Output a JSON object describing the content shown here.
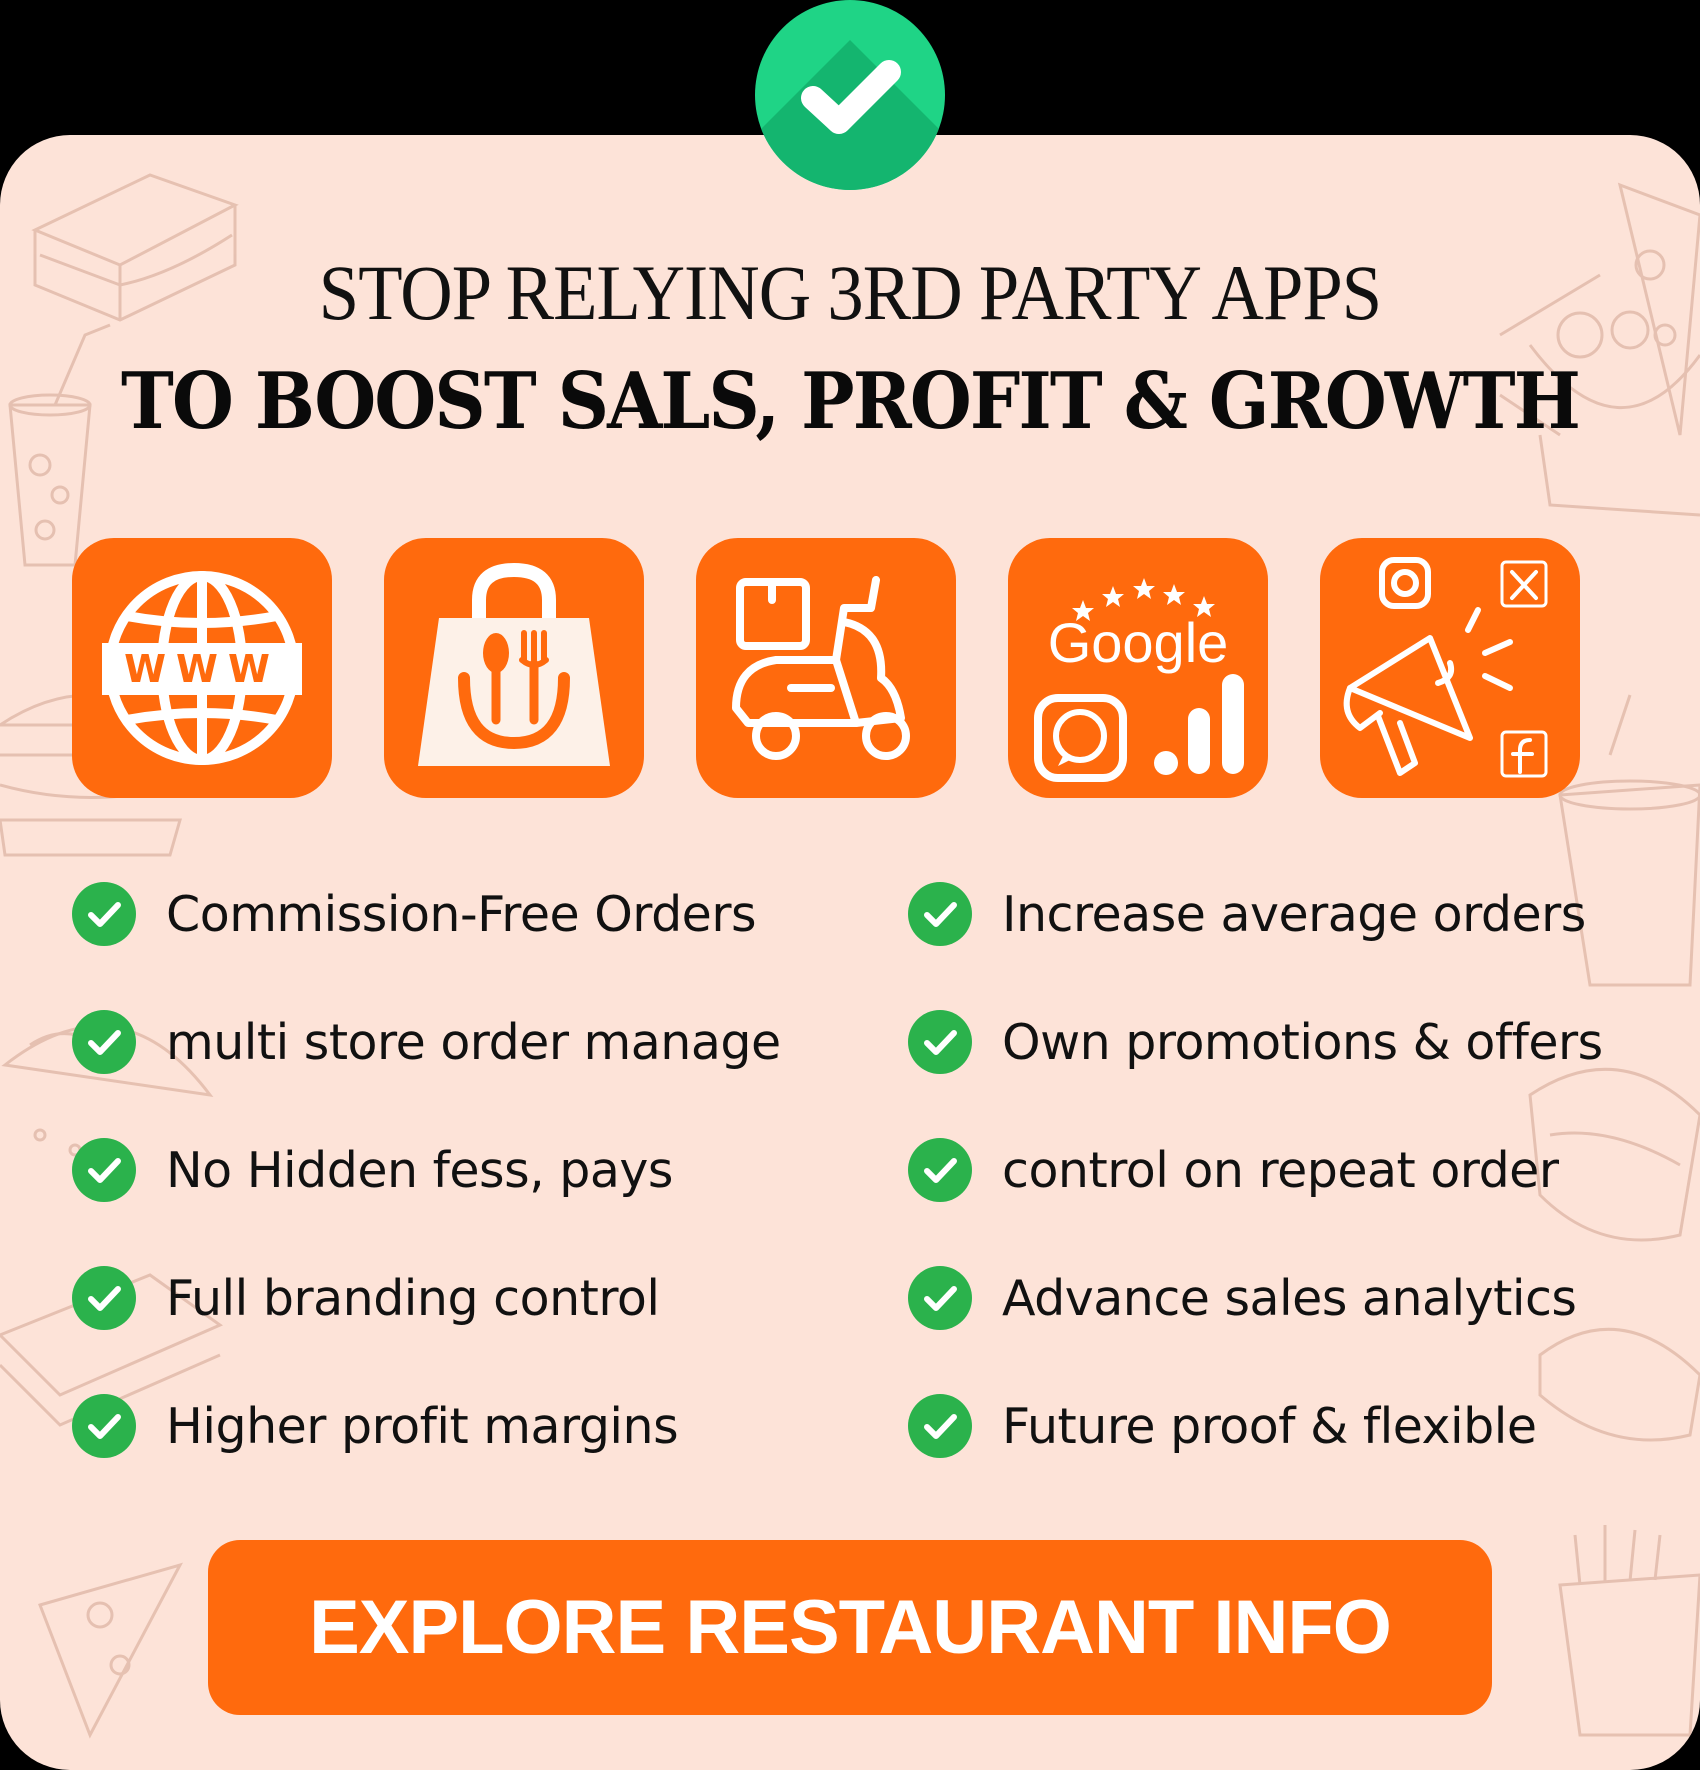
{
  "headline": {
    "line1": "STOP RELYING 3RD PARTY APPS",
    "line2": "TO BOOST SALS, PROFIT & GROWTH"
  },
  "icons": [
    {
      "name": "website-globe-icon",
      "text": "WWW"
    },
    {
      "name": "food-bag-icon"
    },
    {
      "name": "delivery-scooter-icon"
    },
    {
      "name": "google-whatsapp-analytics-icon",
      "text": "Google"
    },
    {
      "name": "social-marketing-icon"
    }
  ],
  "features": {
    "left": [
      "Commission-Free Orders",
      "multi store order manage",
      "No Hidden fess, pays",
      "Full branding control",
      "Higher profit margins"
    ],
    "right": [
      "Increase average orders",
      "Own promotions & offers",
      "control on repeat order",
      "Advance sales analytics",
      "Future proof & flexible"
    ]
  },
  "cta": {
    "label": "EXPLORE RESTAURANT INFO"
  },
  "colors": {
    "background": "#fde3d8",
    "accent": "#ff6a0d",
    "check_green": "#1fd486",
    "feature_check": "#2bb24c",
    "text": "#111111"
  }
}
